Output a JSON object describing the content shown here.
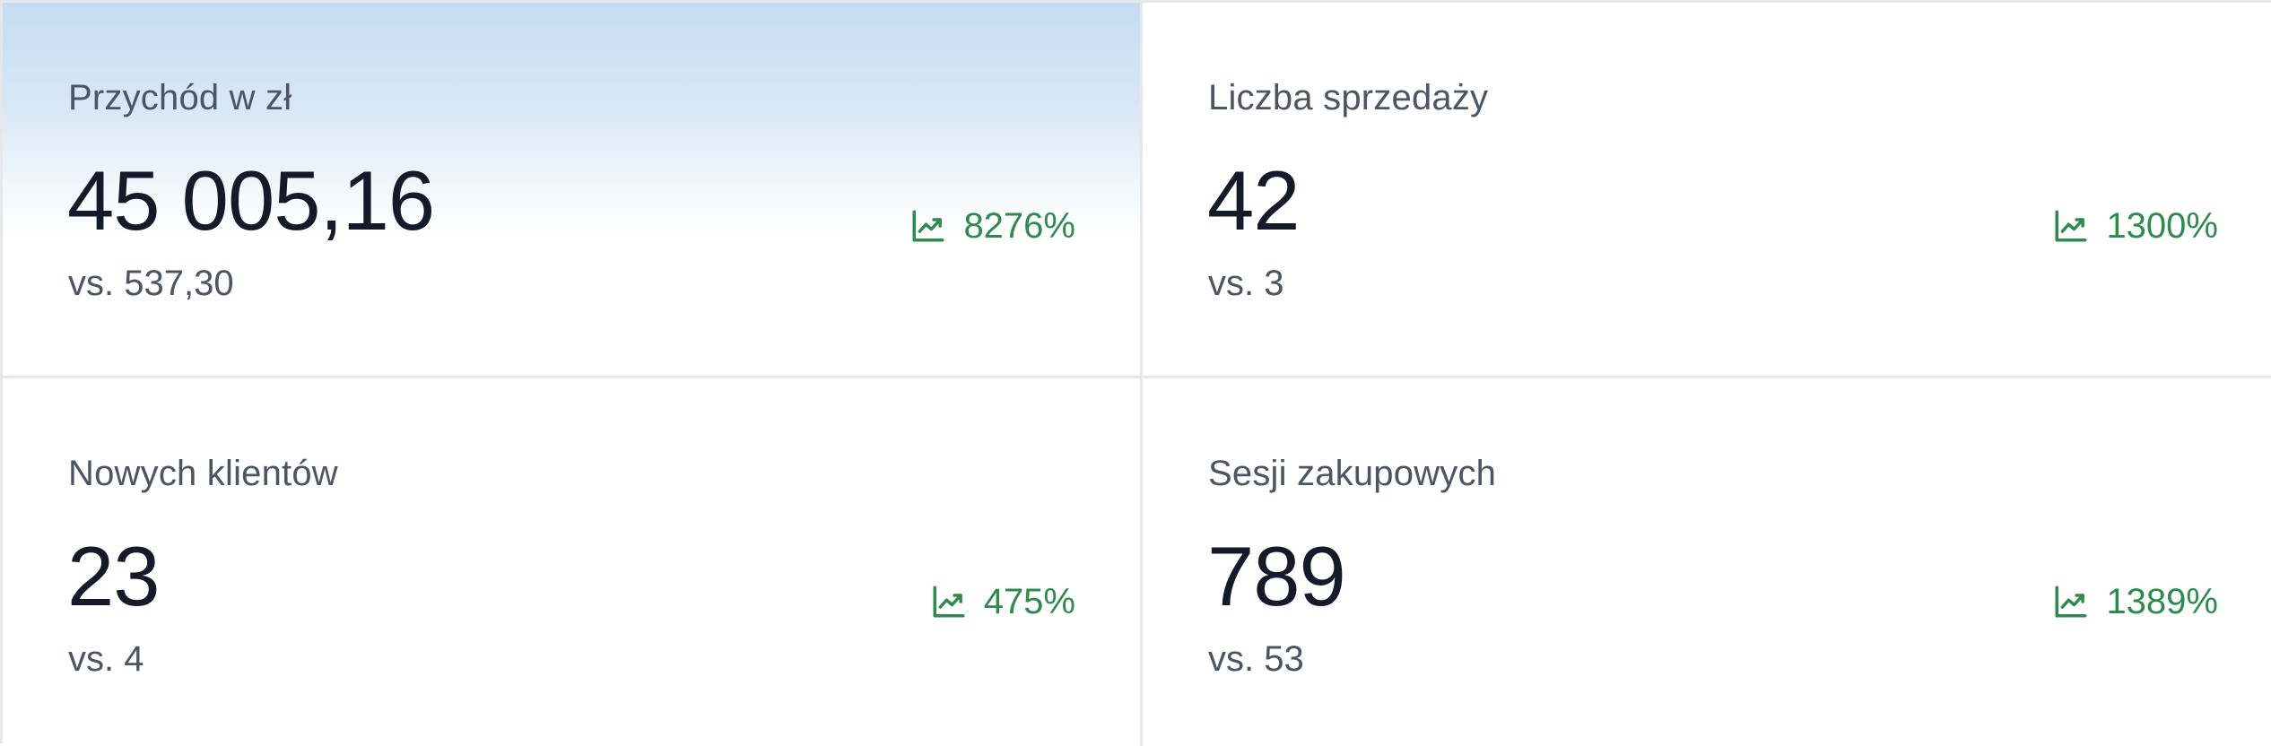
{
  "accent_color": "#2e8b4e",
  "cards": [
    {
      "label": "Przychód w zł",
      "value": "45 005,16",
      "compare": "vs. 537,30",
      "change": "8276%",
      "trend_icon": "trending-up-icon",
      "selected": true
    },
    {
      "label": "Liczba sprzedaży",
      "value": "42",
      "compare": "vs. 3",
      "change": "1300%",
      "trend_icon": "trending-up-icon",
      "selected": false
    },
    {
      "label": "Nowych klientów",
      "value": "23",
      "compare": "vs. 4",
      "change": "475%",
      "trend_icon": "trending-up-icon",
      "selected": false
    },
    {
      "label": "Sesji zakupowych",
      "value": "789",
      "compare": "vs. 53",
      "change": "1389%",
      "trend_icon": "trending-up-icon",
      "selected": false
    }
  ]
}
